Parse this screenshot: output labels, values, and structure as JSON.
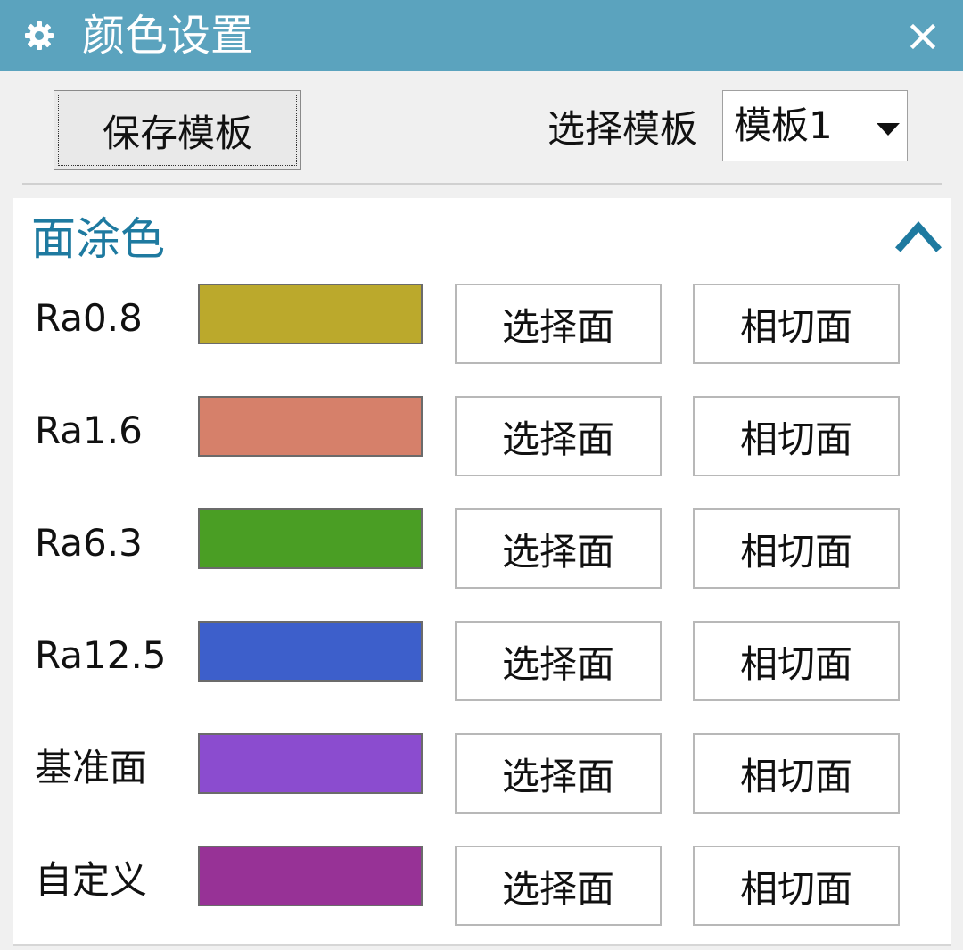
{
  "window": {
    "title": "颜色设置"
  },
  "toolbar": {
    "save_label": "保存模板",
    "template_label": "选择模板",
    "template_value": "模板1"
  },
  "group": {
    "title": "面涂色",
    "rows": [
      {
        "label": "Ra0.8",
        "color": "#bba92c",
        "select_label": "选择面",
        "tangent_label": "相切面"
      },
      {
        "label": "Ra1.6",
        "color": "#d6806a",
        "select_label": "选择面",
        "tangent_label": "相切面"
      },
      {
        "label": "Ra6.3",
        "color": "#4a9e24",
        "select_label": "选择面",
        "tangent_label": "相切面"
      },
      {
        "label": "Ra12.5",
        "color": "#3d5fcb",
        "select_label": "选择面",
        "tangent_label": "相切面"
      },
      {
        "label": "基准面",
        "color": "#8b4ccf",
        "select_label": "选择面",
        "tangent_label": "相切面"
      },
      {
        "label": "自定义",
        "color": "#973296",
        "select_label": "选择面",
        "tangent_label": "相切面"
      }
    ]
  },
  "colors": {
    "titlebar": "#5ba3be",
    "group_title": "#1e7aa0"
  }
}
